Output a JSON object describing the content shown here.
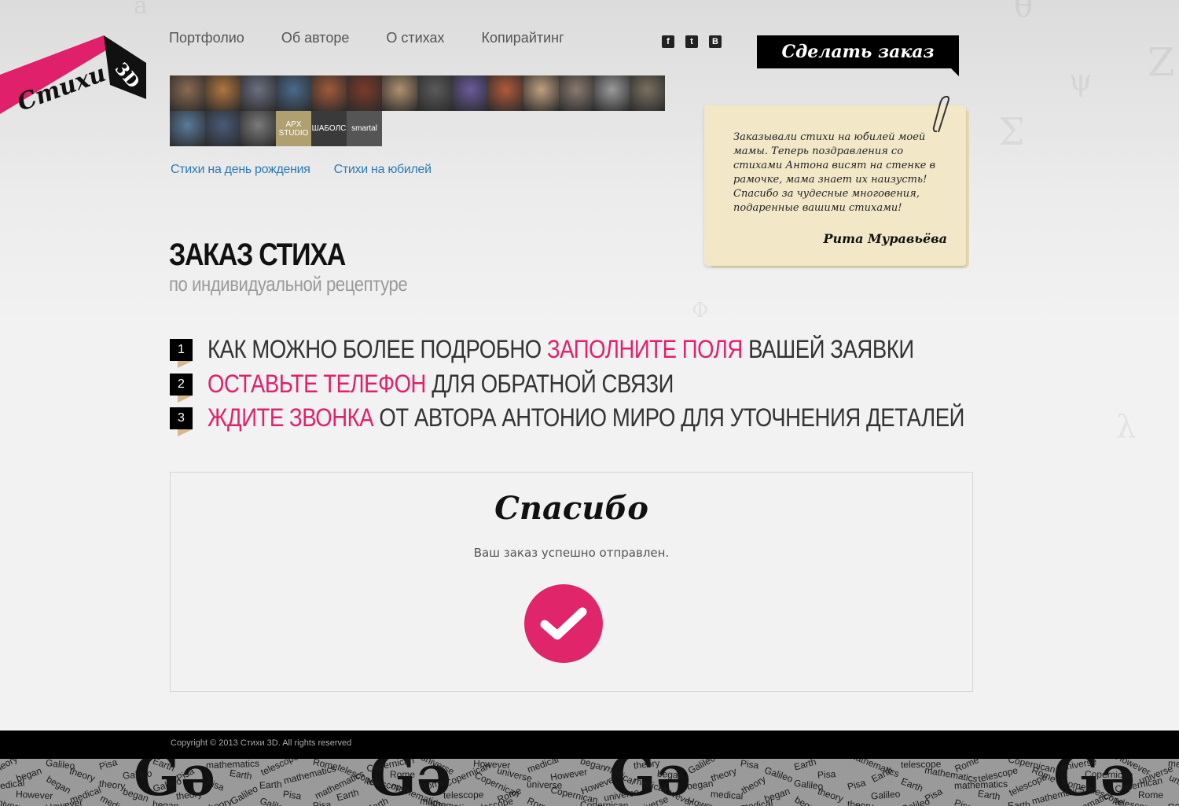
{
  "logo": {
    "text_main": "Стихи",
    "text_3d": "3D",
    "color": "#e0206b"
  },
  "nav": {
    "items": [
      "Портфолио",
      "Об авторе",
      "О стихах",
      "Копирайтинг"
    ]
  },
  "social": [
    {
      "icon": "facebook-icon",
      "glyph": "f"
    },
    {
      "icon": "twitter-icon",
      "glyph": "t"
    },
    {
      "icon": "vk-icon",
      "glyph": "B"
    }
  ],
  "order_button": {
    "label": "Сделать заказ"
  },
  "portfolio_photos": {
    "colors": [
      "#8a6a50",
      "#b0763e",
      "#6b7080",
      "#4a6a8a",
      "#a05a3a",
      "#7a3a2a",
      "#b09070",
      "#5a5a5a",
      "#6a5a9a",
      "#b05a3a",
      "#c0a080",
      "#8a7a70",
      "#9a9a9a",
      "#7a7060",
      "#5a7a9a",
      "#4a5a7a",
      "#7a7a7a",
      "#b0a070",
      "#3a3a3a",
      "#555555"
    ],
    "labeled": [
      {
        "index": 17,
        "text": "APX STUDIO"
      },
      {
        "index": 18,
        "text": "ШАБОЛС"
      },
      {
        "index": 19,
        "text": "smartal"
      }
    ]
  },
  "sub_links": [
    "Стихи на день рождения",
    "Стихи на юбилей"
  ],
  "testimonial": {
    "text": "Заказывали стихи на юбилей моей мамы. Теперь поздравления со стихами Антона висят на стенке в рамочке, мама знает их наизусть! Спасибо за чудесные многовения, подаренные вашими стихами!",
    "author": "Рита Муравьёва"
  },
  "heading": {
    "title": "ЗАКАЗ СТИХА",
    "subtitle": "по индивидуальной рецептуре"
  },
  "steps": [
    {
      "num": "1",
      "before": "КАК МОЖНО БОЛЕЕ ПОДРОБНО ",
      "highlight": "ЗАПОЛНИТЕ ПОЛЯ",
      "after": " ВАШЕЙ ЗАЯВКИ",
      "highlight_first": false
    },
    {
      "num": "2",
      "before": "",
      "highlight": "ОСТАВЬТЕ ТЕЛЕФОН",
      "after": " ДЛЯ ОБРАТНОЙ СВЯЗИ",
      "highlight_first": true
    },
    {
      "num": "3",
      "before": "",
      "highlight": "ЖДИТЕ ЗВОНКА",
      "after": " ОТ АВТОРА АНТОНИО МИРО ДЛЯ УТОЧНЕНИЯ ДЕТАЛЕЙ",
      "highlight_first": true
    }
  ],
  "thanks": {
    "title": "Спасибо",
    "message": "Ваш заказ успешно отправлен.",
    "check_color": "#e0256b"
  },
  "footer": {
    "copyright": "Copyright © 2013 Стихи 3D. All rights reserved",
    "pattern_words": [
      "theory",
      "Galileo",
      "Pisa",
      "Earth",
      "mathematics",
      "telescope",
      "Rome",
      "Copernican",
      "universe",
      "However",
      "medical",
      "began"
    ]
  }
}
